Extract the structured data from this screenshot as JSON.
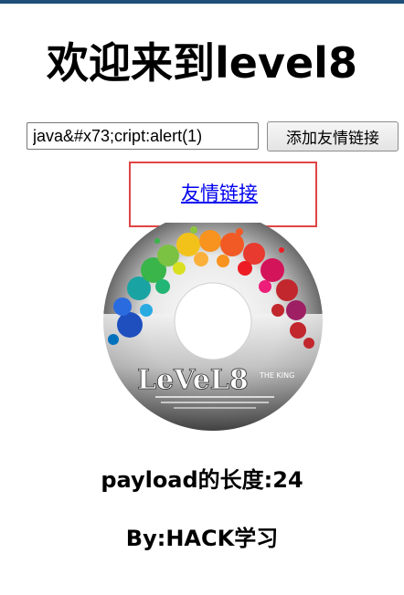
{
  "page": {
    "title": "欢迎来到level8"
  },
  "form": {
    "keyword_value": "java&#x73;cript:alert(1)",
    "submit_label": "添加友情链接"
  },
  "result": {
    "link_text": "友情链接"
  },
  "disc_image": {
    "label_text": "LeVeL8",
    "label_suffix": "THE KING"
  },
  "info": {
    "payload_length": "payload的长度:24",
    "author": "By:HACK学习"
  },
  "colors": {
    "highlight_border": "#e04545",
    "link": "#0000ee",
    "top_bar": "#1f4e79"
  }
}
